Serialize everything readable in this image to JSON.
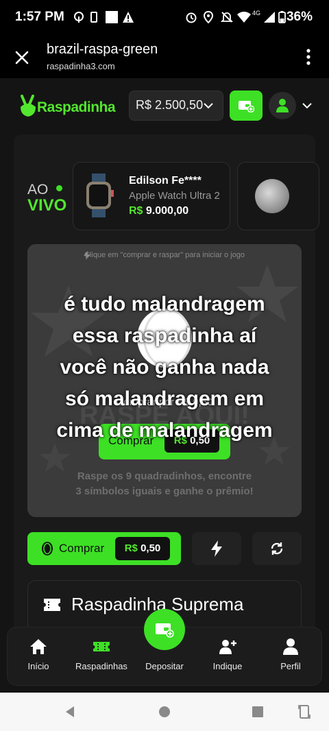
{
  "status_bar": {
    "time": "1:57 PM",
    "battery": "36%",
    "network": "4G"
  },
  "browser": {
    "title": "brazil-raspa-green",
    "url": "raspadinha3.com"
  },
  "header": {
    "logo_text": "Raspadinha",
    "balance": "R$ 2.500,50",
    "accent": "#3de025"
  },
  "live": {
    "ao": "AO",
    "vivo": "VIVO",
    "winner": {
      "name": "Edilson Fe****",
      "prize": "Apple Watch Ultra 2",
      "currency": "R$",
      "amount": "9.000,00"
    }
  },
  "scratch": {
    "hint": "Clique em \"comprar e raspar\" para iniciar o jogo",
    "cta_label": "Comprar por R$ 0,50",
    "buy_label": "Comprar",
    "currency": "R$",
    "price": "0,50",
    "instructions_1": "Raspe os 9 quadradinhos, encontre",
    "instructions_2": "3 símbolos iguais e ganhe o prêmio!",
    "bg_text": "RASPE AQUI!"
  },
  "overlay_caption": {
    "line1": "é tudo malandragem",
    "line2": "essa raspadinha aí",
    "line3": "você não ganha nada",
    "line4": "só malandragem em",
    "line5": "cima de malandragem"
  },
  "actions": {
    "buy_label": "Comprar",
    "currency": "R$",
    "price": "0,50"
  },
  "card": {
    "title": "Raspadinha Suprema"
  },
  "bottom_nav": [
    {
      "label": "Início"
    },
    {
      "label": "Raspadinhas"
    },
    {
      "label": "Depositar"
    },
    {
      "label": "Indique"
    },
    {
      "label": "Perfil"
    }
  ]
}
